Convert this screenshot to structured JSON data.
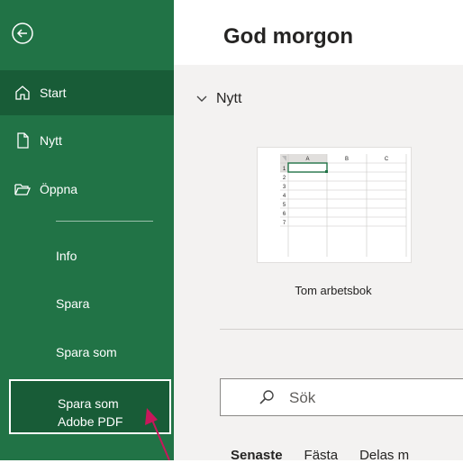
{
  "sidebar": {
    "items": [
      {
        "label": "Start",
        "icon": "home-icon"
      },
      {
        "label": "Nytt",
        "icon": "new-document-icon"
      },
      {
        "label": "Öppna",
        "icon": "open-folder-icon"
      },
      {
        "label": "Info"
      },
      {
        "label": "Spara"
      },
      {
        "label": "Spara som"
      }
    ],
    "pdf_item": {
      "line1": "Spara som",
      "line2": "Adobe PDF"
    }
  },
  "header": {
    "greeting": "God morgon"
  },
  "new_section": {
    "title": "Nytt",
    "template_label": "Tom arbetsbok",
    "thumbnail": {
      "columns": [
        "A",
        "B",
        "C"
      ],
      "rows": [
        "1",
        "2",
        "3",
        "4",
        "5",
        "6",
        "7"
      ]
    }
  },
  "search": {
    "placeholder": "Sök"
  },
  "file_tabs": [
    "Senaste",
    "Fästa",
    "Delas m"
  ],
  "colors": {
    "sidebar_bg": "#217346",
    "sidebar_active": "#185c37",
    "annotation_arrow": "#c8175b"
  }
}
